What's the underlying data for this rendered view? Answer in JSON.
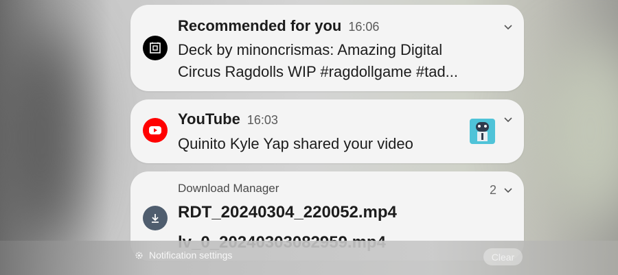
{
  "notifications": [
    {
      "app": "Recommended for you",
      "time": "16:06",
      "icon": "ragdoll-app-icon",
      "body_line1": "Deck by minoncrismas: Amazing Digital",
      "body_line2": "Circus Ragdolls WIP #ragdollgame #tad..."
    },
    {
      "app": "YouTube",
      "time": "16:03",
      "icon": "youtube-icon",
      "body": "Quinito Kyle Yap shared your video",
      "thumbnail": "video-thumbnail"
    },
    {
      "app": "Download Manager",
      "count": "2",
      "icon": "download-icon",
      "file1": "RDT_20240304_220052.mp4",
      "file2": "lv_0_20240303082959.mp4"
    }
  ],
  "footer": {
    "settings_label": "Notification settings",
    "clear_label": "Clear"
  },
  "colors": {
    "youtube_red": "#ff0000",
    "download_icon_bg": "#4f5d6e",
    "card_bg": "#f4f4f4"
  }
}
